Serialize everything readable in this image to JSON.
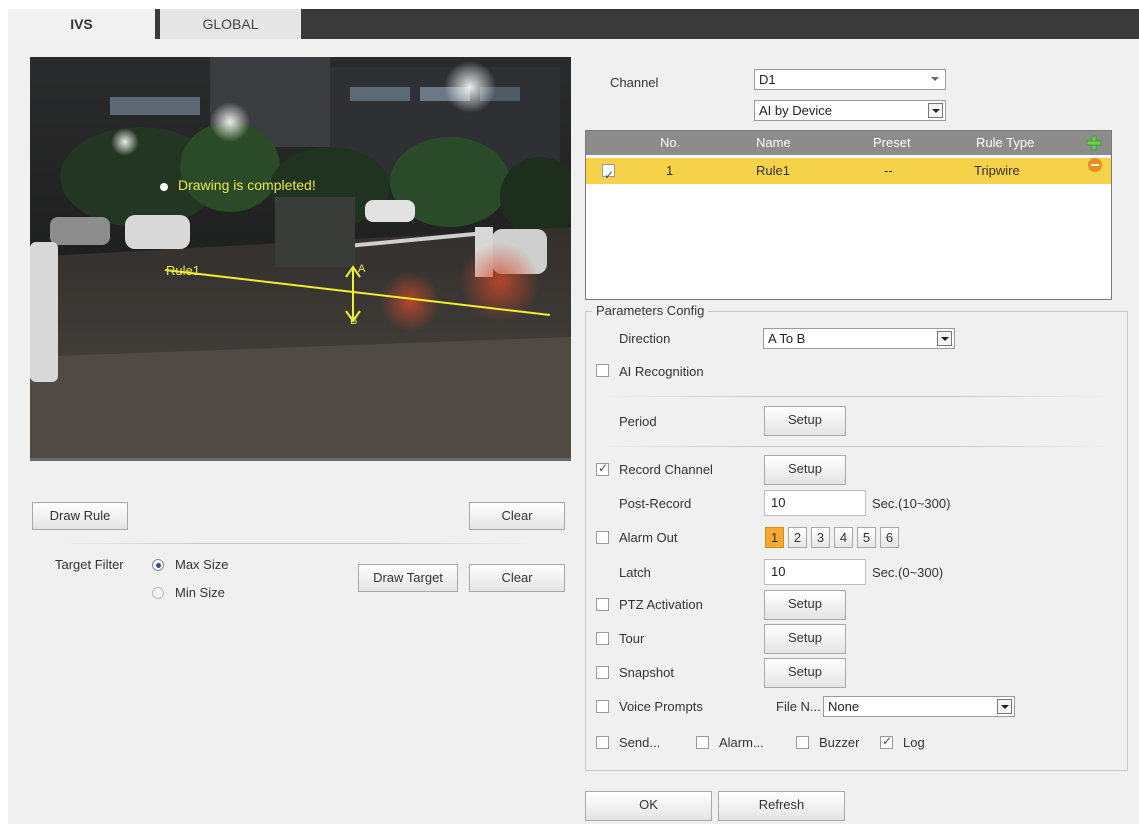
{
  "tabs": {
    "ivs": "IVS",
    "global": "GLOBAL"
  },
  "video": {
    "overlay_message": "Drawing is completed!",
    "rule_label": "Rule1",
    "point_a": "A",
    "point_b": "B"
  },
  "left": {
    "draw_rule": "Draw Rule",
    "clear": "Clear",
    "target_filter_label": "Target Filter",
    "max_size": "Max Size",
    "min_size": "Min Size",
    "draw_target": "Draw Target",
    "clear2": "Clear"
  },
  "channel": {
    "label": "Channel",
    "value": "D1",
    "mode": "AI by Device"
  },
  "rule_table": {
    "headers": {
      "no": "No.",
      "name": "Name",
      "preset": "Preset",
      "rule_type": "Rule Type"
    },
    "rows": [
      {
        "no": "1",
        "name": "Rule1",
        "preset": "--",
        "rule_type": "Tripwire",
        "checked": true
      }
    ]
  },
  "params": {
    "legend": "Parameters Config",
    "direction_label": "Direction",
    "direction_value": "A To B",
    "ai_recognition": "AI Recognition",
    "period": "Period",
    "record_channel": "Record Channel",
    "post_record_label": "Post-Record",
    "post_record_value": "10",
    "post_record_unit": "Sec.(10~300)",
    "alarm_out": "Alarm Out",
    "alarm_channels": [
      "1",
      "2",
      "3",
      "4",
      "5",
      "6"
    ],
    "latch_label": "Latch",
    "latch_value": "10",
    "latch_unit": "Sec.(0~300)",
    "ptz_activation": "PTZ Activation",
    "tour": "Tour",
    "snapshot": "Snapshot",
    "voice_prompts": "Voice Prompts",
    "file_name_label": "File N...",
    "file_name_value": "None",
    "send": "Send...",
    "alarm": "Alarm...",
    "buzzer": "Buzzer",
    "log": "Log",
    "setup": "Setup"
  },
  "footer": {
    "ok": "OK",
    "refresh": "Refresh"
  },
  "colors": {
    "accent": "#f5d24a",
    "tab_bar": "#3a3a3a",
    "alarm_active": "#f6a931",
    "overlay_text": "#e8e84a"
  }
}
